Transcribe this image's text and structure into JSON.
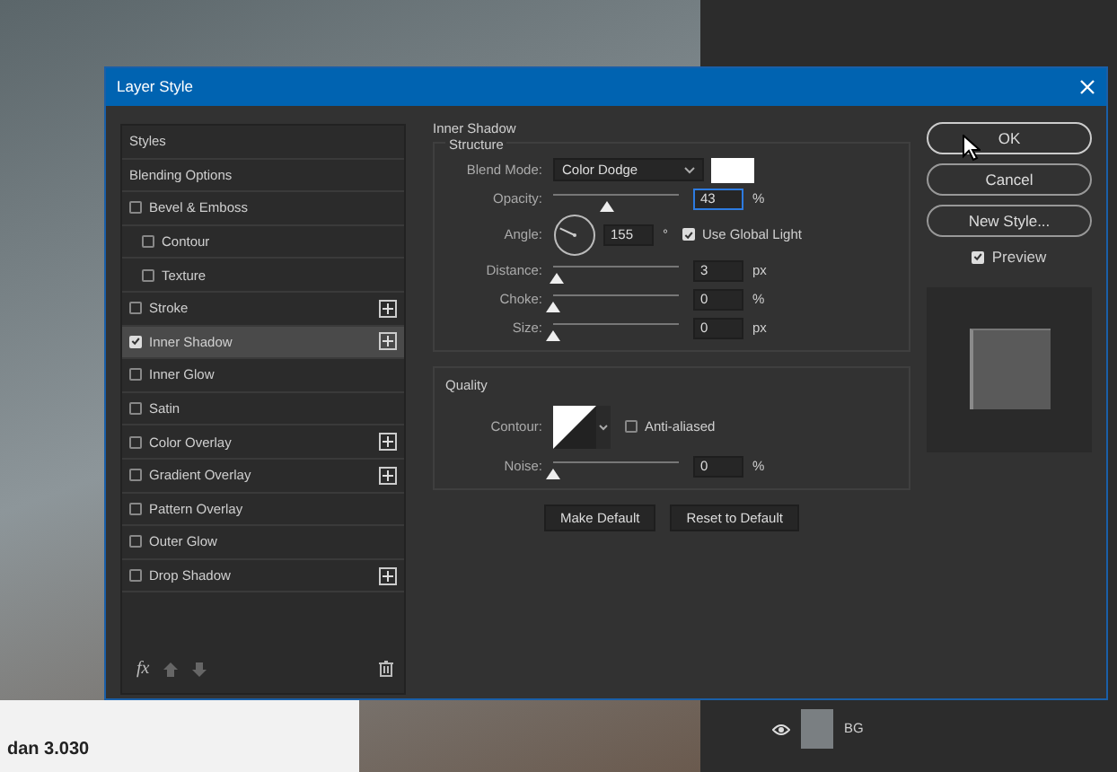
{
  "canvas": {
    "caption": "dan 3.030"
  },
  "layers": [
    {
      "name": "BG",
      "visible": true
    }
  ],
  "dialog": {
    "title": "Layer Style",
    "styles": [
      {
        "label": "Styles",
        "kind": "header",
        "selected": false
      },
      {
        "label": "Blending Options",
        "kind": "header",
        "selected": false
      },
      {
        "label": "Bevel & Emboss",
        "kind": "effect",
        "checked": false,
        "selected": false,
        "addable": false,
        "children": [
          {
            "label": "Contour",
            "kind": "effect",
            "checked": false,
            "selected": false,
            "addable": false
          },
          {
            "label": "Texture",
            "kind": "effect",
            "checked": false,
            "selected": false,
            "addable": false
          }
        ]
      },
      {
        "label": "Stroke",
        "kind": "effect",
        "checked": false,
        "selected": false,
        "addable": true
      },
      {
        "label": "Inner Shadow",
        "kind": "effect",
        "checked": true,
        "selected": true,
        "addable": true
      },
      {
        "label": "Inner Glow",
        "kind": "effect",
        "checked": false,
        "selected": false,
        "addable": false
      },
      {
        "label": "Satin",
        "kind": "effect",
        "checked": false,
        "selected": false,
        "addable": false
      },
      {
        "label": "Color Overlay",
        "kind": "effect",
        "checked": false,
        "selected": false,
        "addable": true
      },
      {
        "label": "Gradient Overlay",
        "kind": "effect",
        "checked": false,
        "selected": false,
        "addable": true
      },
      {
        "label": "Pattern Overlay",
        "kind": "effect",
        "checked": false,
        "selected": false,
        "addable": false
      },
      {
        "label": "Outer Glow",
        "kind": "effect",
        "checked": false,
        "selected": false,
        "addable": false
      },
      {
        "label": "Drop Shadow",
        "kind": "effect",
        "checked": false,
        "selected": false,
        "addable": true
      }
    ],
    "fx_label": "fx",
    "section_title": "Inner Shadow",
    "structure": {
      "title": "Structure",
      "blend_mode": {
        "label": "Blend Mode:",
        "value": "Color Dodge"
      },
      "opacity": {
        "label": "Opacity:",
        "level": 0.43,
        "value": "43",
        "unit": "%"
      },
      "angle": {
        "label": "Angle:",
        "value": "155",
        "unit": "°",
        "global_light": {
          "label": "Use Global Light",
          "checked": true
        }
      },
      "sliders": [
        {
          "label": "Distance:",
          "level": 0.03,
          "value": "3",
          "unit": "px"
        },
        {
          "label": "Choke:",
          "level": 0,
          "value": "0",
          "unit": "%"
        },
        {
          "label": "Size:",
          "level": 0,
          "value": "0",
          "unit": "px"
        }
      ]
    },
    "quality": {
      "title": "Quality",
      "contour_label": "Contour:",
      "anti_aliased": {
        "label": "Anti-aliased",
        "checked": false
      },
      "noise": {
        "label": "Noise:",
        "level": 0,
        "value": "0",
        "unit": "%"
      }
    },
    "buttons": [
      "Make Default",
      "Reset to Default"
    ],
    "actions": [
      "OK",
      "Cancel",
      "New Style..."
    ],
    "preview": {
      "label": "Preview",
      "checked": true
    }
  }
}
